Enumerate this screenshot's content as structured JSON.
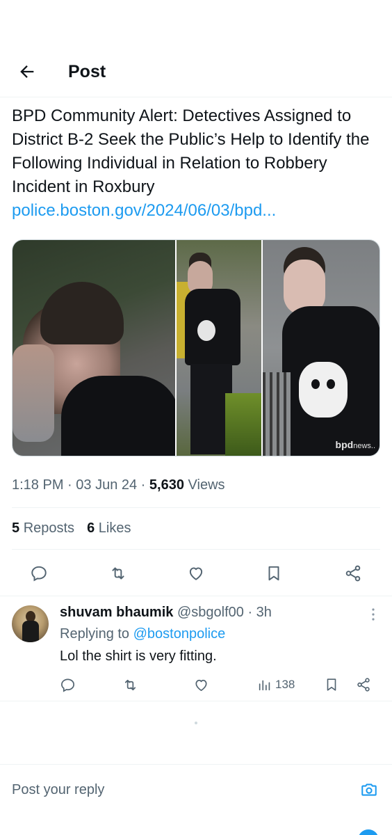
{
  "header": {
    "title": "Post",
    "back_icon": "arrow-left-icon"
  },
  "post": {
    "text": "BPD Community Alert: Detectives Assigned to District B-2 Seek the Public’s Help to Identify the Following Individual in Relation to Robbery Incident in Roxbury",
    "link": "police.boston.gov/2024/06/03/bpd...",
    "watermark": "bpd",
    "watermark_suffix": "news..",
    "time": "1:18 PM",
    "date": "03 Jun 24",
    "views_count": "5,630",
    "views_label": "Views",
    "reposts_count": "5",
    "reposts_label": "Reposts",
    "likes_count": "6",
    "likes_label": "Likes"
  },
  "actions": [
    "comment-icon",
    "repost-icon",
    "like-icon",
    "bookmark-icon",
    "share-icon"
  ],
  "reply": {
    "name": "shuvam bhaumik",
    "handle": "@sbgolf00",
    "age": "· 3h",
    "replying_prefix": "Replying to",
    "replying_to": "@bostonpolice",
    "text": "Lol the shirt is very fitting.",
    "views": "138"
  },
  "compose": {
    "placeholder": "Post your reply"
  },
  "colors": {
    "accent": "#1d9bf0",
    "secondary_text": "#536471",
    "primary_text": "#0f1419"
  }
}
